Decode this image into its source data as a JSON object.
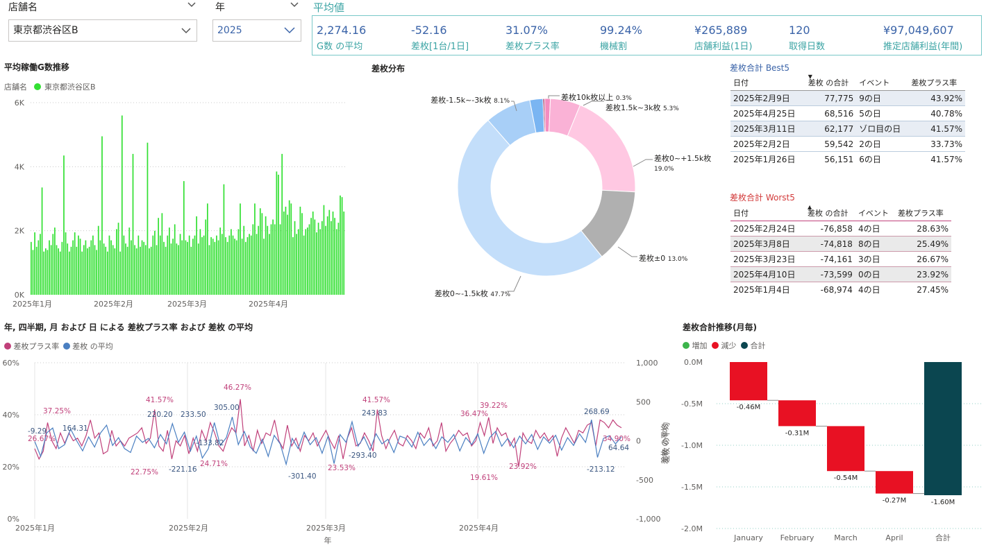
{
  "slicers": {
    "store": {
      "title": "店舗名",
      "value": "東京都渋谷区B"
    },
    "year": {
      "title": "年",
      "value": "2025"
    }
  },
  "kpi": {
    "title": "平均値",
    "items": [
      {
        "value": "2,274.16",
        "label": "G数 の平均"
      },
      {
        "value": "-52.16",
        "label": "差枚[1台/1日]"
      },
      {
        "value": "31.07%",
        "label": "差枚プラス率"
      },
      {
        "value": "99.24%",
        "label": "機械割"
      },
      {
        "value": "¥265,889",
        "label": "店舗利益(1日)"
      },
      {
        "value": "120",
        "label": "取得日数"
      },
      {
        "value": "¥97,049,607",
        "label": "推定店舗利益(年間)"
      }
    ]
  },
  "gchart": {
    "title": "平均稼働G数推移",
    "legend_title": "店舗名",
    "legend_item": "東京都渋谷区B",
    "color": "#33e033",
    "yticks": [
      "6K",
      "4K",
      "2K",
      "0K"
    ],
    "xticks": [
      "2025年1月",
      "2025年2月",
      "2025年3月",
      "2025年4月"
    ]
  },
  "donut": {
    "title": "差枚分布",
    "labels": [
      {
        "name": "差枚10k枚以上",
        "pct": "0.3%"
      },
      {
        "name": "差枚1.5k~3k枚",
        "pct": "5.3%"
      },
      {
        "name": "差枚0~+1.5k枚",
        "pct": "19.0%"
      },
      {
        "name": "差枚±0",
        "pct": "13.0%"
      },
      {
        "name": "差枚0~-1.5k枚",
        "pct": "47.7%"
      },
      {
        "name": "差枚-1.5k~-3k枚",
        "pct": "8.1%"
      }
    ]
  },
  "best5": {
    "title": "差枚合計 Best5",
    "headers": [
      "日付",
      "差枚 の合計",
      "イベント",
      "差枚プラス率"
    ],
    "rows": [
      [
        "2025年2月9日",
        "77,775",
        "9の日",
        "43.92%"
      ],
      [
        "2025年4月25日",
        "68,516",
        "5の日",
        "40.78%"
      ],
      [
        "2025年3月11日",
        "62,177",
        "ゾロ目の日",
        "41.57%"
      ],
      [
        "2025年2月2日",
        "59,542",
        "2の日",
        "33.73%"
      ],
      [
        "2025年1月26日",
        "56,151",
        "6の日",
        "41.57%"
      ]
    ]
  },
  "worst5": {
    "title": "差枚合計 Worst5",
    "headers": [
      "日付",
      "差枚 の合計",
      "イベント",
      "差枚プラス率"
    ],
    "rows": [
      [
        "2025年2月24日",
        "-76,858",
        "4の日",
        "28.63%"
      ],
      [
        "2025年3月8日",
        "-74,818",
        "8の日",
        "25.49%"
      ],
      [
        "2025年3月23日",
        "-74,161",
        "3の日",
        "26.67%"
      ],
      [
        "2025年4月10日",
        "-73,599",
        "0の日",
        "23.92%"
      ],
      [
        "2025年1月4日",
        "-68,974",
        "4の日",
        "27.45%"
      ]
    ]
  },
  "linechart": {
    "title": "年, 四半期, 月 および 日 による 差枚プラス率 および 差枚 の平均",
    "legend": [
      {
        "name": "差枚プラス率",
        "color": "#c0407a"
      },
      {
        "name": "差枚 の平均",
        "color": "#4a7fc1"
      }
    ],
    "yleft": [
      "60%",
      "40%",
      "20%",
      "0%"
    ],
    "yright": [
      "1,000",
      "500",
      "0",
      "-500",
      "-1,000"
    ],
    "yright_title": "差枚 の平均",
    "xticks": [
      "2025年1月",
      "2025年2月",
      "2025年3月",
      "2025年4月"
    ],
    "xtitle": "年",
    "pink_labels": [
      "26.67%",
      "37.25%",
      "41.57%",
      "22.75%",
      "24.71%",
      "46.27%",
      "23.53%",
      "41.57%",
      "36.47%",
      "39.22%",
      "19.61%",
      "23.92%",
      "34.90%"
    ],
    "blue_labels": [
      "-9.29",
      "164.31",
      "220.20",
      "233.50",
      "-133.82",
      "305.00",
      "-221.16",
      "-301.40",
      "-293.40",
      "243.83",
      "268.69",
      "-213.12",
      "64.64"
    ]
  },
  "waterfall": {
    "title": "差枚合計推移(月毎)",
    "legend": [
      {
        "name": "増加",
        "color": "#3cb44b"
      },
      {
        "name": "減少",
        "color": "#e81123"
      },
      {
        "name": "合計",
        "color": "#0b4650"
      }
    ],
    "yticks": [
      "0.0M",
      "-0.5M",
      "-1.0M",
      "-1.5M",
      "-2.0M"
    ],
    "ytitle": "差枚 の平均",
    "categories": [
      "January",
      "February",
      "March",
      "April",
      "合計"
    ],
    "values": [
      -0.46,
      -0.31,
      -0.54,
      -0.27,
      -1.6
    ],
    "labels": [
      "-0.46M",
      "-0.31M",
      "-0.54M",
      "-0.27M",
      "-1.60M"
    ]
  },
  "chart_data": [
    {
      "type": "bar",
      "title": "平均稼働G数推移",
      "xlabel": "",
      "ylabel": "",
      "ylim": [
        0,
        6000
      ],
      "series": [
        {
          "name": "東京都渋谷区B",
          "values": [
            1650,
            1400,
            1950,
            1500,
            1700,
            1900,
            3350,
            1350,
            1450,
            1400,
            1700,
            1550,
            1900,
            2100,
            1550,
            1450,
            1350,
            1650,
            4350,
            1950,
            1600,
            1350,
            1500,
            1700,
            1950,
            1500,
            1850,
            1750,
            1350,
            1550,
            1700,
            1450,
            1500,
            1700,
            1850,
            1550,
            1400,
            2150,
            1700,
            4950,
            1600,
            1500,
            1350,
            1850,
            1700,
            1550,
            1450,
            2050,
            2250,
            1350,
            5600,
            1850,
            1600,
            1500,
            2100,
            1700,
            4400,
            1550,
            1450,
            1850,
            1500,
            1700,
            1650,
            1550,
            4750,
            1450,
            1500,
            1850,
            2000,
            1550,
            2400,
            1850,
            2550,
            1650,
            1500,
            1850,
            2100,
            1600,
            1750,
            2200,
            1600,
            1550,
            1900,
            1700,
            3550,
            1700,
            1650,
            1850,
            1500,
            1750,
            1850,
            2450,
            1600,
            2050,
            1800,
            1850,
            2350,
            2850,
            1550,
            1800,
            1750,
            1650,
            1850,
            1700,
            2100,
            1900,
            3450,
            1800,
            1650,
            1850,
            2050,
            1850,
            1750,
            1700,
            2050,
            2850,
            1750,
            2150,
            1650,
            1800,
            1900,
            1850,
            2200,
            2850,
            1900,
            2150,
            2700,
            2550,
            1750,
            2450,
            2150,
            1900,
            2200,
            2350,
            2200,
            3850,
            3750,
            2200,
            4400,
            2600,
            2750,
            2500,
            2950,
            2850,
            1800,
            2300,
            1900,
            2050,
            2750,
            2550,
            1850,
            2050,
            2100,
            2200,
            2400,
            2600,
            2350,
            1950,
            2250,
            2050,
            2300,
            2800,
            2150,
            2450,
            2650,
            2300,
            2600,
            2400,
            2050,
            2250,
            3100,
            3050,
            2600
          ]
        }
      ]
    },
    {
      "type": "pie",
      "title": "差枚分布",
      "categories": [
        "差枚10k枚以上",
        "差枚1.5k~3k枚",
        "差枚0~+1.5k枚",
        "差枚±0",
        "差枚0~-1.5k枚",
        "差枚-1.5k~-3k枚"
      ],
      "values": [
        0.3,
        5.3,
        19.0,
        13.0,
        47.7,
        8.1
      ]
    },
    {
      "type": "line",
      "title": "年, 四半期, 月 および 日 による 差枚プラス率 および 差枚 の平均",
      "xlabel": "年",
      "x": [
        "2025年1月",
        "2025年2月",
        "2025年3月",
        "2025年4月"
      ],
      "ylim": [
        0,
        60
      ],
      "y2lim": [
        -1000,
        1000
      ],
      "series": [
        {
          "name": "差枚プラス率",
          "values": [
            27,
            23,
            26,
            37,
            30,
            27,
            33,
            29,
            33,
            30,
            31,
            28,
            32,
            38,
            31,
            33,
            25,
            26,
            34,
            28,
            30,
            28,
            31,
            32,
            33,
            35,
            29,
            31,
            42,
            28,
            26,
            34,
            23,
            30,
            28,
            32,
            25,
            31,
            26,
            34,
            30,
            37,
            33,
            28,
            26,
            31,
            35,
            33,
            46,
            28,
            32,
            26,
            34,
            29,
            33,
            32,
            38,
            30,
            27,
            36,
            28,
            31,
            26,
            32,
            30,
            33,
            28,
            31,
            34,
            30,
            27,
            32,
            23,
            31,
            35,
            28,
            29,
            33,
            30,
            26,
            42,
            32,
            27,
            31,
            34,
            29,
            28,
            32,
            30,
            27,
            33,
            31,
            35,
            28,
            30,
            37,
            26,
            29,
            31,
            34,
            32,
            33,
            28,
            30,
            37,
            32,
            39,
            29,
            35,
            32,
            33,
            28,
            31,
            20,
            33,
            30,
            29,
            34,
            31,
            33,
            30,
            32,
            24,
            31,
            35,
            32,
            29,
            34,
            33,
            36,
            37,
            28,
            38,
            37,
            35,
            38,
            36,
            35
          ]
        },
        {
          "name": "差枚 の平均",
          "values": [
            -9,
            -200,
            100,
            164,
            -100,
            -50,
            150,
            0,
            -130,
            50,
            -80,
            100,
            200,
            -60,
            40,
            -100,
            -150,
            60,
            -20,
            30,
            -90,
            80,
            -40,
            220,
            -20,
            110,
            -133,
            60,
            -221,
            -100,
            233,
            -60,
            40,
            305,
            -50,
            120,
            -80,
            -160,
            20,
            -200,
            70,
            -40,
            -301,
            30,
            -100,
            110,
            -50,
            40,
            -160,
            60,
            -293,
            80,
            -20,
            244,
            -70,
            50,
            -120,
            90,
            -40,
            20,
            -150,
            60,
            30,
            -80,
            110,
            -60,
            30,
            -100,
            50,
            -20,
            80,
            -130,
            40,
            -50,
            90,
            -160,
            40,
            120,
            -70,
            30,
            -90,
            60,
            -40,
            80,
            -110,
            50,
            -30,
            70,
            -120,
            40,
            -60,
            90,
            -20,
            269,
            -213,
            30,
            65,
            -40,
            50
          ]
        }
      ]
    },
    {
      "type": "bar",
      "title": "差枚合計推移(月毎)",
      "categories": [
        "January",
        "February",
        "March",
        "April",
        "合計"
      ],
      "values": [
        -0.46,
        -0.31,
        -0.54,
        -0.27,
        -1.6
      ],
      "ylabel": "差枚 の平均",
      "ylim": [
        -2.0,
        0.0
      ]
    }
  ]
}
